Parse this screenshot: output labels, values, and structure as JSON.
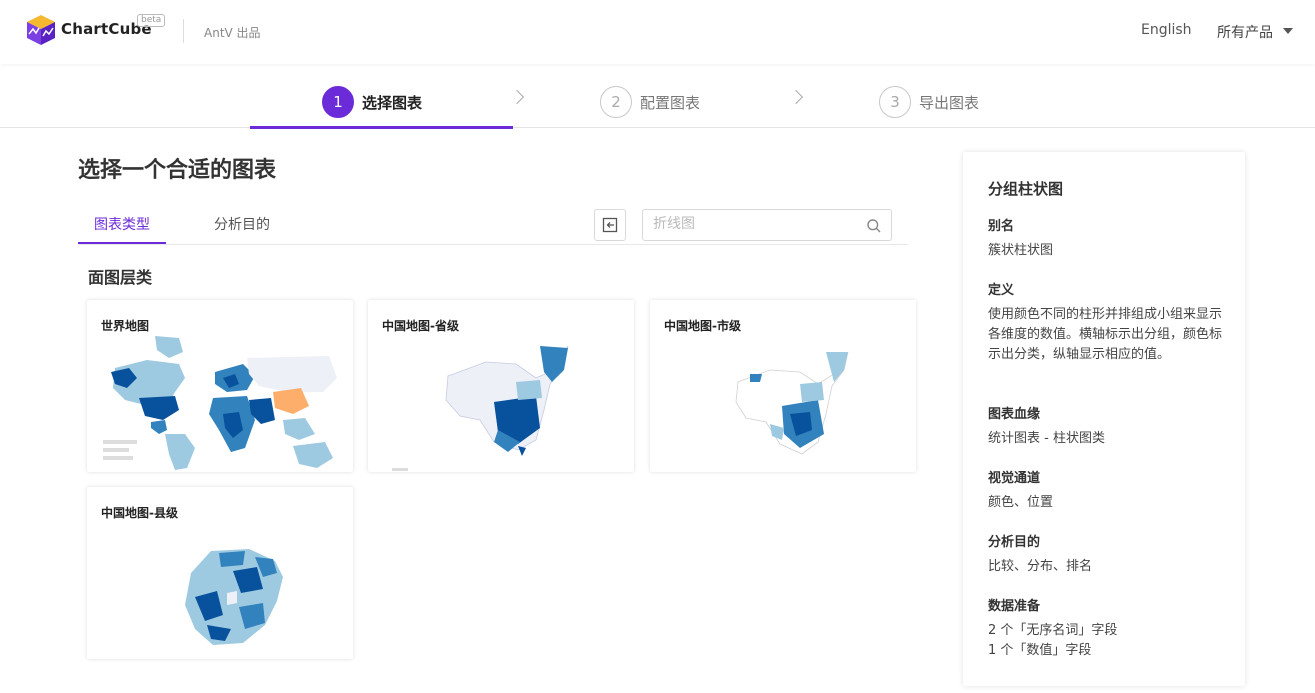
{
  "header": {
    "app_name": "ChartCube",
    "badge": "beta",
    "brand_sub": "AntV 出品",
    "lang": "English",
    "products": "所有产品"
  },
  "steps": [
    {
      "num": "1",
      "label": "选择图表",
      "active": true
    },
    {
      "num": "2",
      "label": "配置图表",
      "active": false
    },
    {
      "num": "3",
      "label": "导出图表",
      "active": false
    }
  ],
  "main": {
    "title": "选择一个合适的图表",
    "tabs": [
      {
        "label": "图表类型",
        "active": true
      },
      {
        "label": "分析目的",
        "active": false
      }
    ],
    "search_placeholder": "折线图",
    "section_title": "面图层类",
    "cards": [
      {
        "title": "世界地图"
      },
      {
        "title": "中国地图-省级"
      },
      {
        "title": "中国地图-市级"
      },
      {
        "title": "中国地图-县级"
      }
    ]
  },
  "detail": {
    "name": "分组柱状图",
    "fields": [
      {
        "label": "别名",
        "value": "簇状柱状图"
      },
      {
        "label": "定义",
        "value": "使用颜色不同的柱形并排组成小组来显示各维度的数值。横轴标示出分组，颜色标示出分类，纵轴显示相应的值。"
      },
      {
        "label": "图表血缘",
        "value": "统计图表 - 柱状图类"
      },
      {
        "label": "视觉通道",
        "value": "颜色、位置"
      },
      {
        "label": "分析目的",
        "value": "比较、分布、排名"
      },
      {
        "label": "数据准备",
        "value": "2 个「无序名词」字段",
        "value2": "1 个「数值」字段"
      }
    ]
  },
  "colors": {
    "accent": "#6c2bd9",
    "map_dark": "#08519c",
    "map_mid": "#3182bd",
    "map_light": "#9ecae1",
    "map_pale": "#eef0f8",
    "map_highlight": "#fdae6b"
  }
}
